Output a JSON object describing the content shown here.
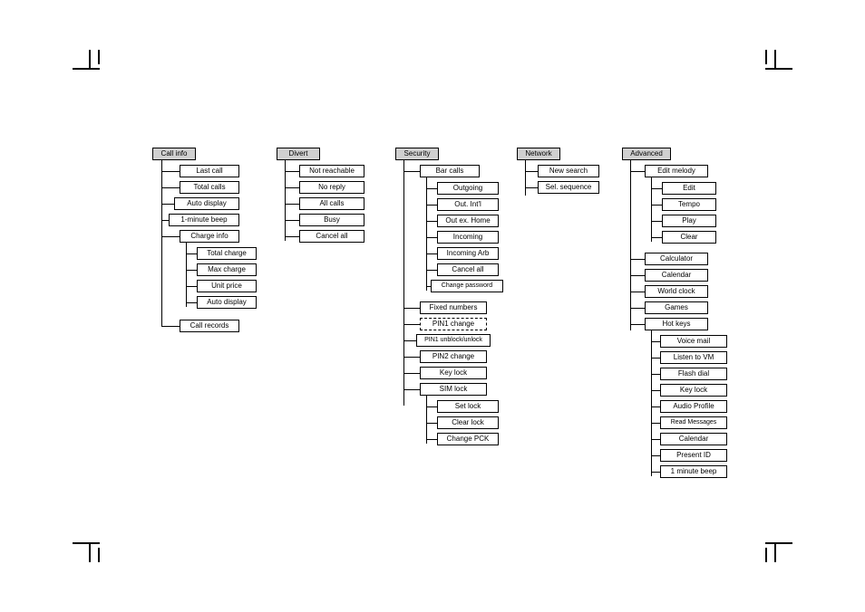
{
  "callinfo": {
    "title": "Call info",
    "items": [
      "Last call",
      "Total calls",
      "Auto display",
      "1-minute beep"
    ],
    "chargeInfoTitle": "Charge info",
    "chargeItems": [
      "Total charge",
      "Max charge",
      "Unit price",
      "Auto display"
    ],
    "callRecords": "Call records"
  },
  "divert": {
    "title": "Divert",
    "items": [
      "Not reachable",
      "No reply",
      "All calls",
      "Busy",
      "Cancel all"
    ]
  },
  "security": {
    "title": "Security",
    "barCallsTitle": "Bar calls",
    "barItems": [
      "Outgoing",
      "Out. Int'l",
      "Out ex. Home",
      "Incoming",
      "Incoming Arb",
      "Cancel all",
      "Change password"
    ],
    "fixedNumbers": "Fixed numbers",
    "pin1change": "PIN1 change",
    "pin1unblock": "PIN1 unblock/unlock",
    "pin2change": "PIN2 change",
    "keyLock": "Key lock",
    "simLockTitle": "SIM lock",
    "simItems": [
      "Set lock",
      "Clear lock",
      "Change PCK"
    ]
  },
  "network": {
    "title": "Network",
    "items": [
      "New search",
      "Sel. sequence"
    ]
  },
  "advanced": {
    "title": "Advanced",
    "editMelodyTitle": "Edit melody",
    "editMelodyItems": [
      "Edit",
      "Tempo",
      "Play",
      "Clear"
    ],
    "mid": [
      "Calculator",
      "Calendar",
      "World clock",
      "Games"
    ],
    "hotKeysTitle": "Hot keys",
    "hotItems": [
      "Voice mail",
      "Listen to VM",
      "Flash dial",
      "Key lock",
      "Audio Profile",
      "Read Messages",
      "Calendar",
      "Present ID",
      "1 minute beep"
    ]
  }
}
